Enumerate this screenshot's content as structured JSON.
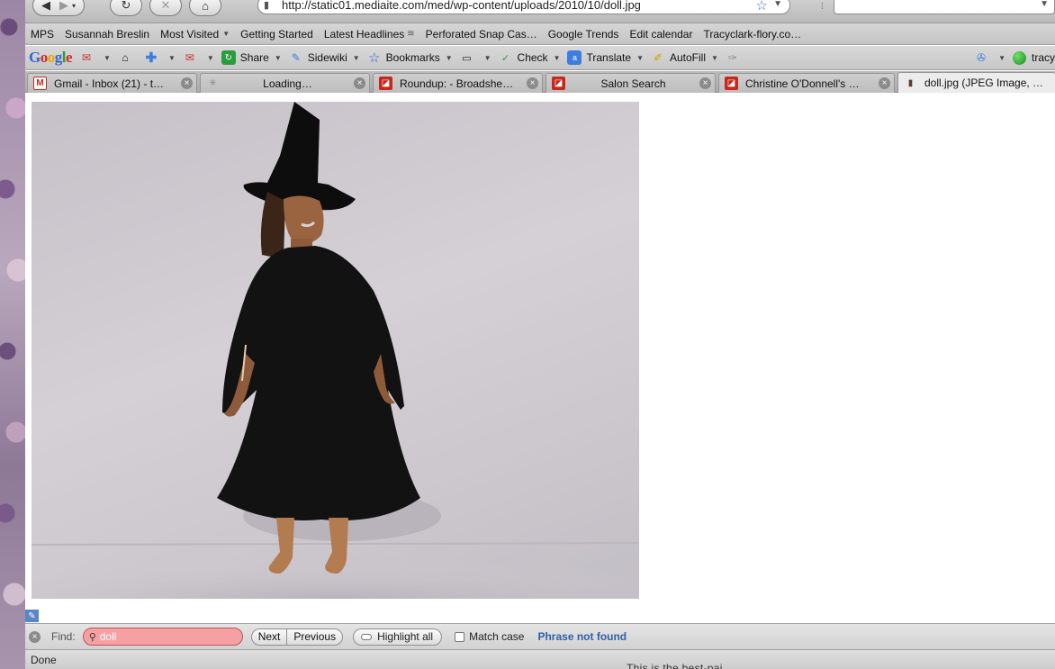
{
  "nav": {
    "url": "http://static01.mediaite.com/med/wp-content/uploads/2010/10/doll.jpg",
    "search_value": ""
  },
  "bookmarks": [
    {
      "label": "MPS",
      "caret": false,
      "rss": false
    },
    {
      "label": "Susannah Breslin",
      "caret": false,
      "rss": false
    },
    {
      "label": "Most Visited",
      "caret": true,
      "rss": false
    },
    {
      "label": "Getting Started",
      "caret": false,
      "rss": false
    },
    {
      "label": "Latest Headlines",
      "caret": false,
      "rss": true
    },
    {
      "label": "Perforated Snap Cas…",
      "caret": false,
      "rss": false
    },
    {
      "label": "Google Trends",
      "caret": false,
      "rss": false
    },
    {
      "label": "Edit calendar",
      "caret": false,
      "rss": false
    },
    {
      "label": "Tracyclark-flory.co…",
      "caret": false,
      "rss": false
    }
  ],
  "google_toolbar": {
    "logo": "Google",
    "share": "Share",
    "sidewiki": "Sidewiki",
    "bookmarks": "Bookmarks",
    "check": "Check",
    "translate": "Translate",
    "autofill": "AutoFill",
    "user": "tracy"
  },
  "tabs": [
    {
      "label": "Gmail - Inbox (21) - t…",
      "icon": "gmail-icon",
      "active": false
    },
    {
      "label": "Loading…",
      "icon": "loading-icon",
      "active": false
    },
    {
      "label": "Roundup: - Broadshe…",
      "icon": "salon-icon",
      "active": false
    },
    {
      "label": "Salon Search",
      "icon": "salon-icon",
      "active": false
    },
    {
      "label": "Christine O'Donnell's …",
      "icon": "salon-icon",
      "active": false
    },
    {
      "label": "doll.jpg (JPEG Image, …",
      "icon": "doll-icon",
      "active": true
    }
  ],
  "find_bar": {
    "label": "Find:",
    "query": "doll",
    "next": "Next",
    "previous": "Previous",
    "highlight_all": "Highlight all",
    "match_case": "Match case",
    "status": "Phrase not found"
  },
  "status_bar": {
    "text": "Done",
    "behind_text": "This is the best-pai"
  },
  "colors": {
    "find_not_found_bg": "#f6a0a4",
    "status_link": "#3060a8",
    "salon_red": "#c8281c"
  }
}
